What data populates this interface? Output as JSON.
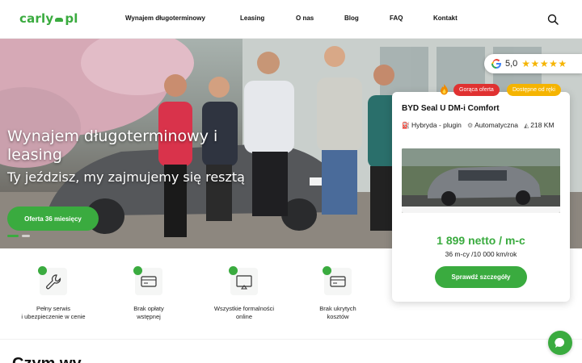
{
  "brand": {
    "logo_left": "carly",
    "logo_right": "pl",
    "accent": "#3aab3f"
  },
  "nav": [
    "Wynajem długoterminowy",
    "Leasing",
    "O nas",
    "Blog",
    "FAQ",
    "Kontakt"
  ],
  "header_icons": [
    "search-icon"
  ],
  "hero": {
    "title": "Wynajem długoterminowy i leasing",
    "subtitle": "Ty jeździsz, my zajmujemy się resztą",
    "cta": "Oferta 36 miesięcy",
    "slides": 2
  },
  "rating": {
    "icon": "google-icon",
    "value": "5,0",
    "stars": "★★★★★",
    "star_count": 5
  },
  "offer": {
    "badge_hot": "Gorąca oferta",
    "badge_available": "Dostępne od ręki",
    "title": "BYD Seal U DM-i Comfort",
    "spec_fuel": "Hybryda - plugin",
    "spec_gearbox": "Automatyczna",
    "spec_power": "218 KM",
    "price": "1 899 netto / m-c",
    "terms": "36 m-cy /10 000 km/rok",
    "cta": "Sprawdź szczegóły",
    "colors": {
      "hot": "#e03131",
      "available": "#f5b400"
    }
  },
  "features": [
    {
      "label": "Pełny serwis\ni ubezpieczenie w cenie",
      "icon": "wrench-icon"
    },
    {
      "label": "Brak opłaty\nwstępnej",
      "icon": "card-icon"
    },
    {
      "label": "Wszystkie formalności\nonline",
      "icon": "monitor-icon"
    },
    {
      "label": "Brak ukrytych\nkosztów",
      "icon": "card-icon"
    }
  ],
  "section_heading": "Czym wy",
  "chat": {
    "icon": "chat-icon"
  }
}
